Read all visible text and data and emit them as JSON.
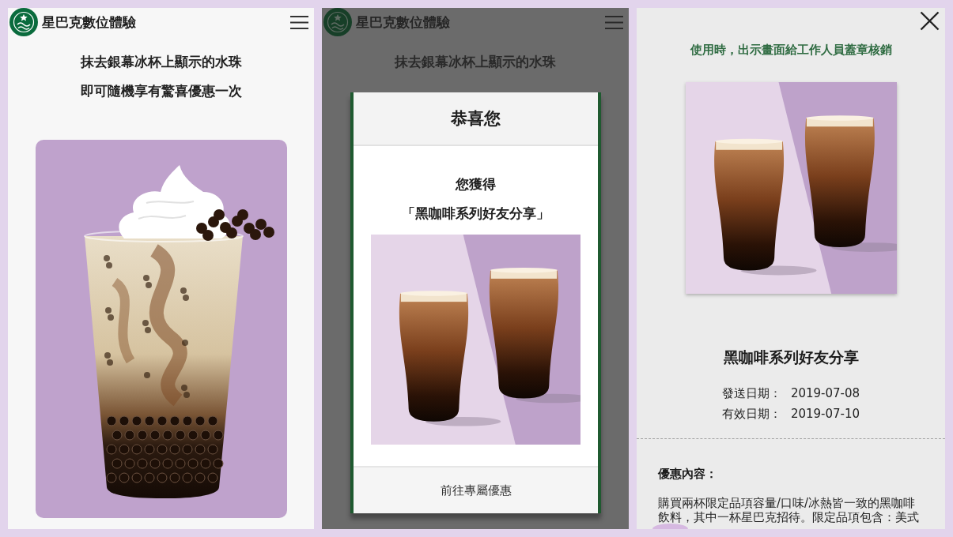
{
  "screens": [
    {
      "kind": "scratch",
      "header": {
        "title": "星巴克數位體驗"
      },
      "instructions": [
        "抹去銀幕冰杯上顯示的水珠",
        "即可隨機享有驚喜優惠一次"
      ]
    },
    {
      "kind": "prize",
      "header": {
        "title": "星巴克數位體驗"
      },
      "instructions": [
        "抹去銀幕冰杯上顯示的水珠"
      ],
      "dialog": {
        "title": "恭喜您",
        "message": "您獲得",
        "prize": "「黑咖啡系列好友分享」",
        "button": "前往專屬優惠"
      }
    },
    {
      "kind": "coupon",
      "notice": "使用時，出示畫面給工作人員蓋章核銷",
      "title": "黑咖啡系列好友分享",
      "dates": [
        {
          "label": "發送日期：",
          "value": "2019-07-08"
        },
        {
          "label": "有效日期：",
          "value": "2019-07-10"
        }
      ],
      "details": {
        "heading": "優惠內容：",
        "text": "購買兩杯限定品項容量/口味/冰熱皆一致的黑咖啡飲料，其中一杯星巴克招待。限定品項包含：美式"
      }
    }
  ]
}
